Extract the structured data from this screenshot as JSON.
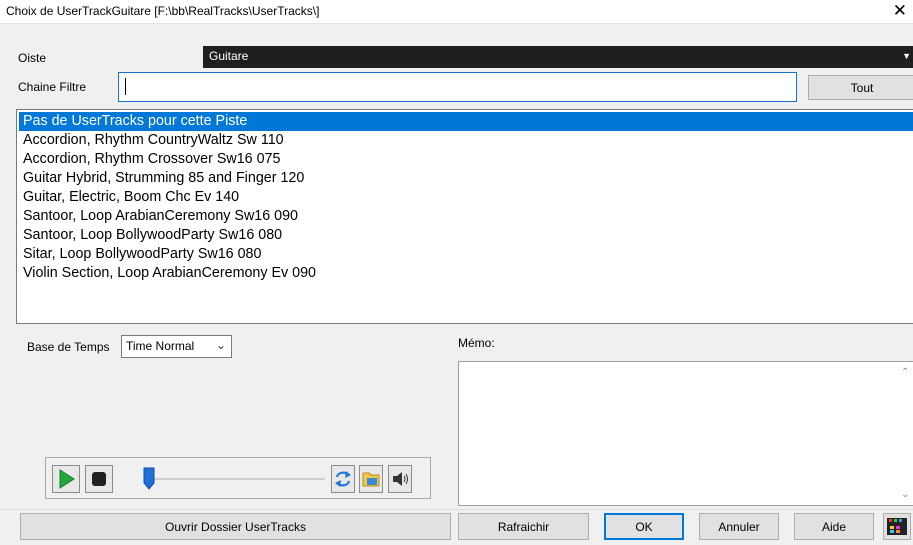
{
  "window": {
    "title": "Choix de UserTrackGuitare  [F:\\bb\\RealTracks\\UserTracks\\]"
  },
  "piste": {
    "label": "Oiste",
    "value": "Guitare"
  },
  "filter": {
    "label": "Chaine Filtre",
    "value": "",
    "all_button": "Tout"
  },
  "list": {
    "items": [
      "Pas de UserTracks pour cette Piste",
      "Accordion, Rhythm CountryWaltz Sw 110",
      "Accordion, Rhythm Crossover Sw16 075",
      "Guitar Hybrid, Strumming 85 and Finger 120",
      "Guitar, Electric, Boom Chc Ev 140",
      "Santoor, Loop ArabianCeremony Sw16 090",
      "Santoor, Loop BollywoodParty Sw16 080",
      "Sitar, Loop BollywoodParty Sw16 080",
      "Violin Section, Loop ArabianCeremony Ev 090"
    ],
    "selected_index": 0
  },
  "timebase": {
    "label": "Base de Temps",
    "value": "Time Normal"
  },
  "memo": {
    "label": "Mémo:",
    "value": ""
  },
  "transport": {
    "position": 0.0
  },
  "buttons": {
    "open_folder": "Ouvrir Dossier UserTracks",
    "refresh": "Rafraichir",
    "ok": "OK",
    "cancel": "Annuler",
    "help": "Aide"
  },
  "colors": {
    "accent": "#0078d7",
    "play": "#22a83a",
    "dark_bar": "#1f1f1f"
  }
}
